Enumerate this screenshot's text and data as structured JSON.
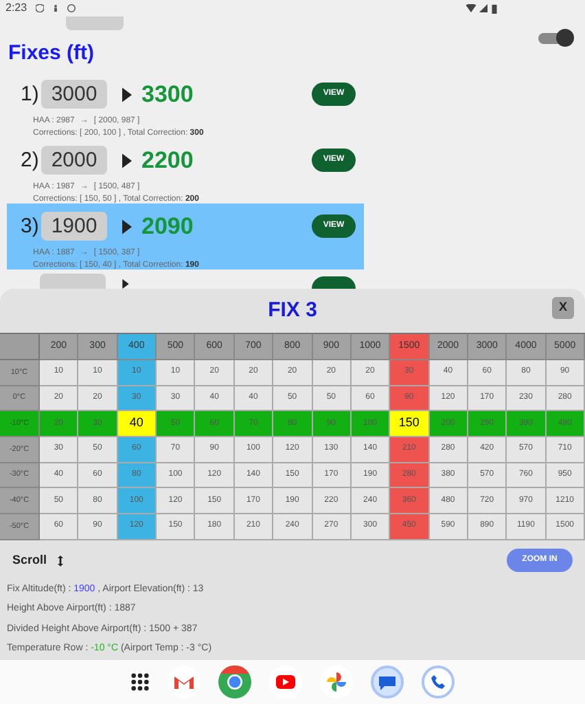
{
  "status_bar": {
    "time": "2:23"
  },
  "temp": {
    "toggle_on": true
  },
  "fixes_title": "Fixes (ft)",
  "fixes": [
    {
      "number": "1)",
      "altitude": "3000",
      "corrected": "3300",
      "button": "VIEW",
      "haa": "HAA : 2987",
      "arrow": "→",
      "split": "[ 2000, 987 ]",
      "corrections": "Corrections: [ 200, 100 ] , Total Correction: ",
      "total": "300",
      "selected": false
    },
    {
      "number": "2)",
      "altitude": "2000",
      "corrected": "2200",
      "button": "VIEW",
      "haa": "HAA : 1987",
      "arrow": "→",
      "split": "[ 1500, 487 ]",
      "corrections": "Corrections: [ 150, 50 ] , Total Correction: ",
      "total": "200",
      "selected": false
    },
    {
      "number": "3)",
      "altitude": "1900",
      "corrected": "2090",
      "button": "VIEW",
      "haa": "HAA : 1887",
      "arrow": "→",
      "split": "[ 1500, 387 ]",
      "corrections": "Corrections: [ 150, 40 ] , Total Correction: ",
      "total": "190",
      "selected": true
    },
    {
      "kind": "covered",
      "selected": false
    }
  ],
  "dialog": {
    "title": "FIX 3",
    "close": "X",
    "table": {
      "columns": [
        {
          "label": "200",
          "selected": false
        },
        {
          "label": "300",
          "selected": false
        },
        {
          "label": "400",
          "selected": true,
          "color": "#3db3e3"
        },
        {
          "label": "500",
          "selected": false
        },
        {
          "label": "600",
          "selected": false
        },
        {
          "label": "700",
          "selected": false
        },
        {
          "label": "800",
          "selected": false
        },
        {
          "label": "900",
          "selected": false
        },
        {
          "label": "1000",
          "selected": false
        },
        {
          "label": "1500",
          "selected": true,
          "color": "#ef5350"
        },
        {
          "label": "2000",
          "selected": false
        },
        {
          "label": "3000",
          "selected": false
        },
        {
          "label": "4000",
          "selected": false
        },
        {
          "label": "5000",
          "selected": false
        }
      ],
      "rows": [
        {
          "label": "10°C",
          "selected": false,
          "cells": [
            "10",
            "10",
            "10",
            "10",
            "20",
            "20",
            "20",
            "20",
            "20",
            "30",
            "40",
            "60",
            "80",
            "90"
          ]
        },
        {
          "label": "0°C",
          "selected": false,
          "cells": [
            "20",
            "20",
            "30",
            "30",
            "40",
            "40",
            "50",
            "50",
            "60",
            "90",
            "120",
            "170",
            "230",
            "280"
          ]
        },
        {
          "label": "-10°C",
          "selected": true,
          "cells": [
            "20",
            "30",
            "40",
            "50",
            "60",
            "70",
            "80",
            "90",
            "100",
            "150",
            "200",
            "290",
            "390",
            "490"
          ]
        },
        {
          "label": "-20°C",
          "selected": false,
          "cells": [
            "30",
            "50",
            "60",
            "70",
            "90",
            "100",
            "120",
            "130",
            "140",
            "210",
            "280",
            "420",
            "570",
            "710"
          ]
        },
        {
          "label": "-30°C",
          "selected": false,
          "cells": [
            "40",
            "60",
            "80",
            "100",
            "120",
            "140",
            "150",
            "170",
            "190",
            "280",
            "380",
            "570",
            "760",
            "950"
          ]
        },
        {
          "label": "-40°C",
          "selected": false,
          "cells": [
            "50",
            "80",
            "100",
            "120",
            "150",
            "170",
            "190",
            "220",
            "240",
            "360",
            "480",
            "720",
            "970",
            "1210"
          ]
        },
        {
          "label": "-50°C",
          "selected": false,
          "cells": [
            "60",
            "90",
            "120",
            "150",
            "180",
            "210",
            "240",
            "270",
            "300",
            "450",
            "590",
            "890",
            "1190",
            "1500"
          ]
        }
      ]
    },
    "scroll_label": "Scroll",
    "zoom_button": "ZOOM IN",
    "info_lines": [
      {
        "before": "Fix Altitude(ft) : ",
        "value": "1900",
        "color": "#3d3dff",
        "after": " , Airport Elevation(ft) : 13"
      },
      {
        "before": "Height Above Airport(ft) : 1887"
      },
      {
        "before": "Divided Height Above Airport(ft) : 1500 + 387"
      },
      {
        "before": "Temperature Row : ",
        "value": "-10 °C",
        "color": "#22b522",
        "after": " (Airport Temp : -3 °C)"
      }
    ]
  }
}
